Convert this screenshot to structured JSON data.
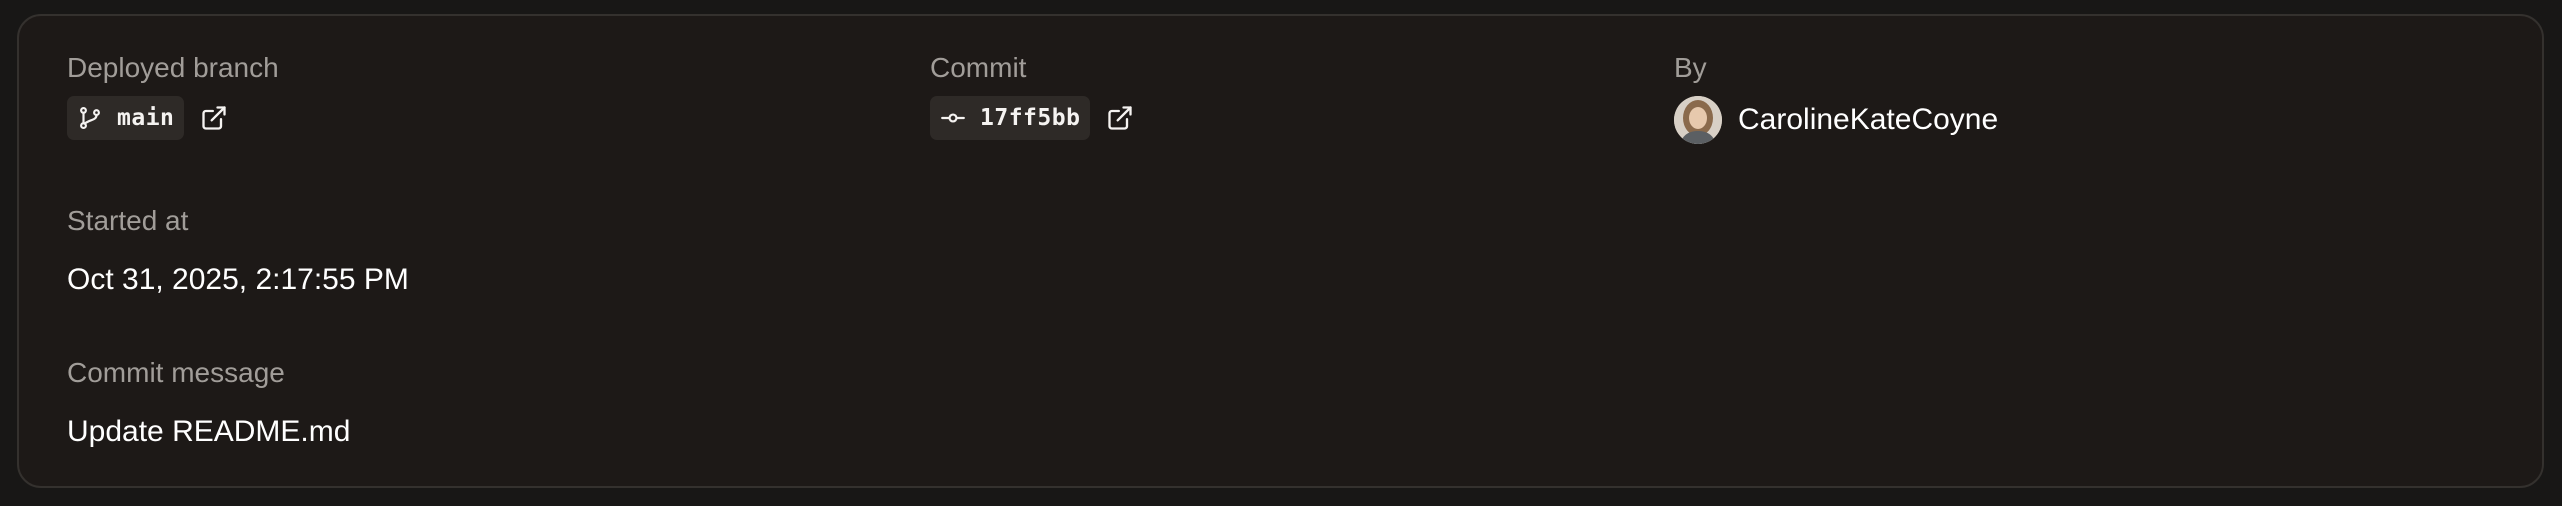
{
  "deployment": {
    "branch": {
      "label": "Deployed branch",
      "name": "main"
    },
    "commit": {
      "label": "Commit",
      "sha": "17ff5bb"
    },
    "author": {
      "label": "By",
      "username": "CarolineKateCoyne"
    },
    "started": {
      "label": "Started at",
      "value": "Oct 31, 2025, 2:17:55 PM"
    },
    "message": {
      "label": "Commit message",
      "value": "Update README.md"
    }
  },
  "icons": {
    "branch": "git-branch-icon",
    "commit": "git-commit-icon",
    "external": "external-link-icon"
  },
  "colors": {
    "background": "#181716",
    "card": "#1d1917",
    "border": "#34312e",
    "chip": "#2e2a27",
    "label": "#a19d99",
    "value": "#ffffff"
  }
}
